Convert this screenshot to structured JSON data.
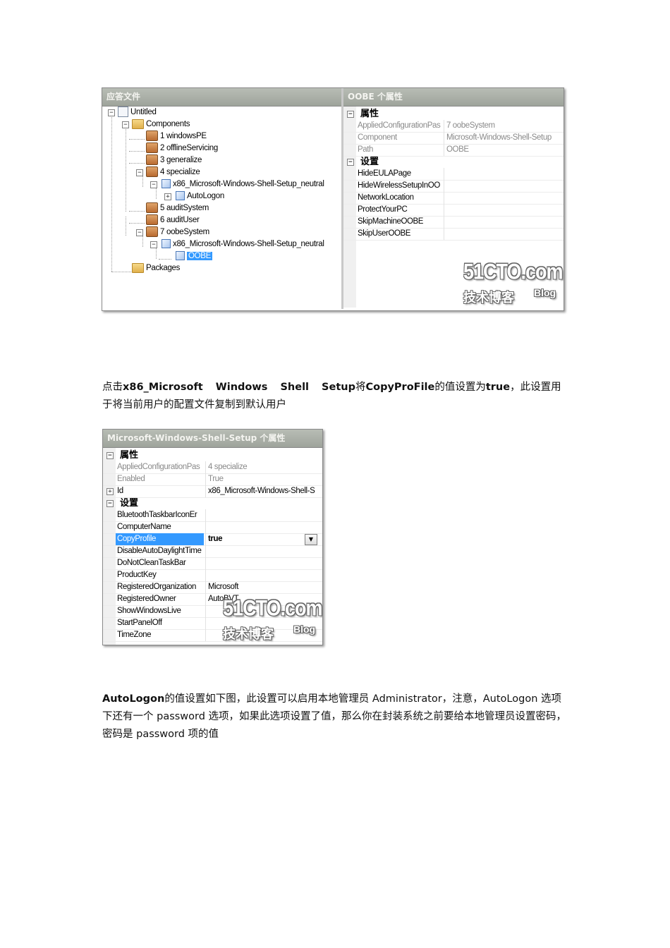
{
  "screenshot1": {
    "left_title": "应答文件",
    "right_title": "OOBE 个属性",
    "tree": [
      {
        "label": "Untitled"
      },
      {
        "label": "Components"
      },
      {
        "label": "1 windowsPE"
      },
      {
        "label": "2 offlineServicing"
      },
      {
        "label": "3 generalize"
      },
      {
        "label": "4 specialize"
      },
      {
        "label": "x86_Microsoft-Windows-Shell-Setup_neutral"
      },
      {
        "label": "AutoLogon"
      },
      {
        "label": "5 auditSystem"
      },
      {
        "label": "6 auditUser"
      },
      {
        "label": "7 oobeSystem"
      },
      {
        "label": "x86_Microsoft-Windows-Shell-Setup_neutral"
      },
      {
        "label": "OOBE"
      },
      {
        "label": "Packages"
      }
    ],
    "grid": {
      "cat_properties": "属性",
      "properties": [
        {
          "name": "AppliedConfigurationPas",
          "value": "7 oobeSystem"
        },
        {
          "name": "Component",
          "value": "Microsoft-Windows-Shell-Setup"
        },
        {
          "name": "Path",
          "value": "OOBE"
        }
      ],
      "cat_settings": "设置",
      "settings": [
        {
          "name": "HideEULAPage",
          "value": ""
        },
        {
          "name": "HideWirelessSetupInOO",
          "value": ""
        },
        {
          "name": "NetworkLocation",
          "value": ""
        },
        {
          "name": "ProtectYourPC",
          "value": ""
        },
        {
          "name": "SkipMachineOOBE",
          "value": ""
        },
        {
          "name": "SkipUserOOBE",
          "value": ""
        }
      ]
    },
    "watermark": {
      "main": "51CTO.com",
      "sub": "技术博客",
      "blog": "Blog"
    }
  },
  "para1": {
    "t1": "点击",
    "b1": "x86_Microsoft Windows Shell Setup",
    "t2": "将",
    "b2": "CopyProFile",
    "t3": "的值设置为",
    "b3": "true",
    "t4": "，此设置用于将当前用户的配置文件复制到默认用户"
  },
  "screenshot2": {
    "title": "Microsoft-Windows-Shell-Setup 个属性",
    "cat_properties": "属性",
    "properties": [
      {
        "name": "AppliedConfigurationPas",
        "value": "4 specialize"
      },
      {
        "name": "Enabled",
        "value": "True"
      },
      {
        "name": "Id",
        "value": "x86_Microsoft-Windows-Shell-S"
      }
    ],
    "cat_settings": "设置",
    "settings": [
      {
        "name": "BluetoothTaskbarIconEr",
        "value": ""
      },
      {
        "name": "ComputerName",
        "value": ""
      },
      {
        "name": "CopyProfile",
        "value": "true"
      },
      {
        "name": "DisableAutoDaylightTime",
        "value": ""
      },
      {
        "name": "DoNotCleanTaskBar",
        "value": ""
      },
      {
        "name": "ProductKey",
        "value": ""
      },
      {
        "name": "RegisteredOrganization",
        "value": "Microsoft"
      },
      {
        "name": "RegisteredOwner",
        "value": "AutoBVT"
      },
      {
        "name": "ShowWindowsLive",
        "value": ""
      },
      {
        "name": "StartPanelOff",
        "value": ""
      },
      {
        "name": "TimeZone",
        "value": ""
      }
    ],
    "watermark": {
      "main": "51CTO.com",
      "sub": "技术博客",
      "blog": "Blog"
    }
  },
  "para2": {
    "b1": "AutoLogon",
    "t1": "的值设置如下图，此设置可以启用本地管理员 Administrator，注意，AutoLogon 选项下还有一个 password 选项，如果此选项设置了值，那么你在封装系统之前要给本地管理员设置密码，密码是 password 项的值"
  }
}
